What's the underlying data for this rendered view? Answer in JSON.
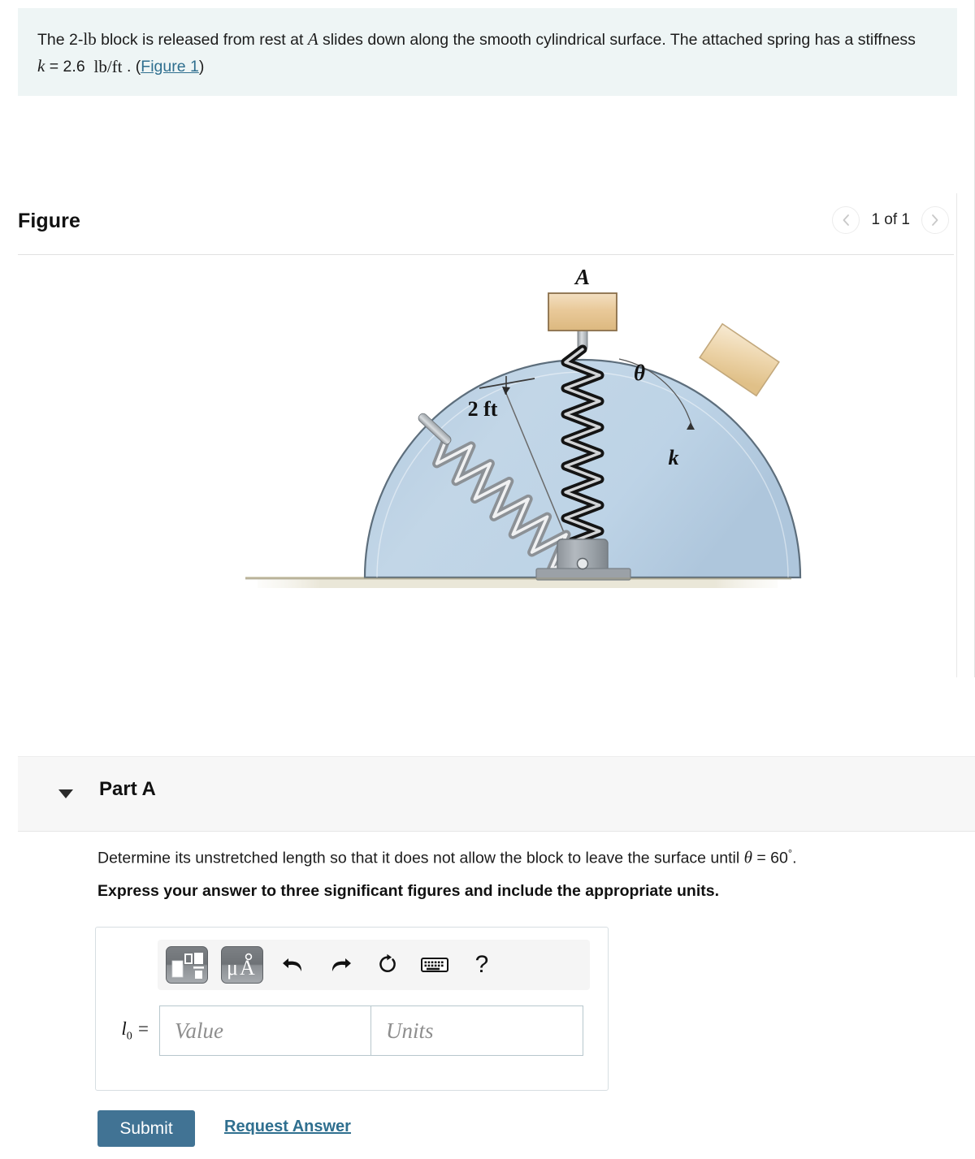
{
  "statement": {
    "part1": "The 2-",
    "unit_lb": "lb",
    "part2": " block is released from rest at ",
    "var_A": "A",
    "part3": " slides down along the smooth cylindrical surface. The attached spring has a stiffness ",
    "var_k": "k",
    "eq": "= 2.6",
    "unit_k": "lb/ft",
    "period": ".",
    "paren_open": "(",
    "figure_link": "Figure 1",
    "paren_close": ")"
  },
  "figure": {
    "title": "Figure",
    "prev_icon": "chevron-left-icon",
    "next_icon": "chevron-right-icon",
    "counter": "1 of 1",
    "labels": {
      "block_a": "A",
      "radius": "2 ft",
      "theta": "θ",
      "spring_k": "k"
    },
    "colors": {
      "dome_fill": "#bdd3e6",
      "dome_stroke": "#5a6b7a",
      "block_fill": "#e8c89a",
      "block_stroke": "#8a6f4a",
      "ground": "#d8d2b8",
      "pivot": "#9aa0a6",
      "spring_dark": "#1f1f1f",
      "spring_light": "#c9cbcd"
    }
  },
  "part_a": {
    "caret_icon": "caret-down-icon",
    "label": "Part A",
    "question": "Determine its unstretched length so that it does not allow the block to leave the surface until ",
    "theta": "θ",
    "question_eq": "= 60",
    "degree": "°",
    "question_end": ".",
    "instruction": "Express your answer to three significant figures and include the appropriate units."
  },
  "answer": {
    "toolbar": [
      {
        "name": "template-math-button",
        "icon": "math-template-icon",
        "label": ""
      },
      {
        "name": "units-button",
        "icon": "micro-angstrom-icon",
        "label": "μA"
      },
      {
        "name": "undo-button",
        "icon": "undo-arrow-icon",
        "label": ""
      },
      {
        "name": "redo-button",
        "icon": "redo-arrow-icon",
        "label": ""
      },
      {
        "name": "reset-button",
        "icon": "reset-circular-arrow-icon",
        "label": ""
      },
      {
        "name": "keyboard-button",
        "icon": "keyboard-icon",
        "label": ""
      },
      {
        "name": "help-button",
        "icon": "question-mark-icon",
        "label": "?"
      }
    ],
    "variable_label": "l",
    "variable_sub": "0",
    "equals": "=",
    "value_placeholder": "Value",
    "value": "",
    "units_placeholder": "Units",
    "units": ""
  },
  "actions": {
    "submit_label": "Submit",
    "request_answer_label": "Request Answer",
    "submit_color": "#417394",
    "link_color": "#2f6f8f"
  }
}
